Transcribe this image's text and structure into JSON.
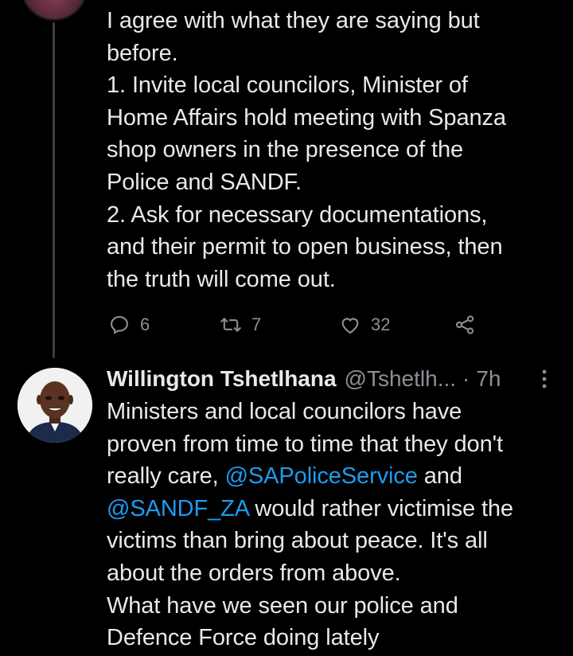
{
  "tweet1": {
    "text": "I agree with what they are saying but\nbefore.\n1. Invite local councilors, Minister of\nHome Affairs hold meeting with Spanza\nshop owners in the presence of the\nPolice and SANDF.\n2. Ask for necessary documentations,\nand their permit to open business, then\nthe truth will come out.",
    "actions": {
      "reply_count": "6",
      "retweet_count": "7",
      "like_count": "32"
    },
    "icons": [
      "reply-icon",
      "retweet-icon",
      "like-icon",
      "share-icon"
    ]
  },
  "tweet2": {
    "author_name": "Willington Tshetlhana",
    "handle": "@Tshetlh...",
    "separator": "·",
    "time": "7h",
    "text_parts": {
      "p1": "Ministers and local councilors have\nproven from time to time that they don't\nreally care, ",
      "mention1": "@SAPoliceService",
      "p2": "  and\n",
      "mention2": "@SANDF_ZA",
      "p3": "  would rather victimise the\nvictims than bring about peace. It's all\nabout the orders from above.\nWhat have we seen our police and\nDefence Force doing lately"
    }
  },
  "colors": {
    "background": "#000000",
    "text": "#e7e9ea",
    "secondary": "#71767b",
    "link": "#1d9bf0",
    "thread_line": "#3a3d41"
  }
}
